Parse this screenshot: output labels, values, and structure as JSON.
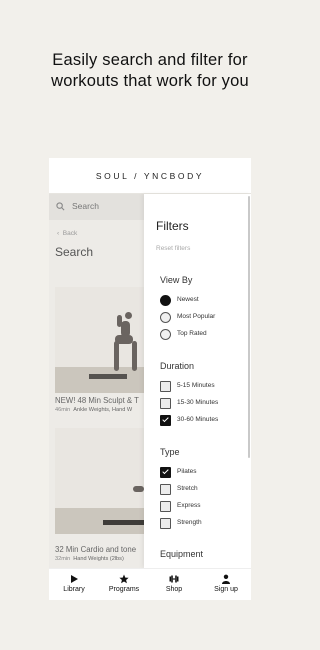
{
  "headline": {
    "line1": "Easily search and filter for",
    "line2": "workouts that work for you"
  },
  "brand": "SOUL / YNCBODY",
  "background_list": {
    "search_placeholder": "Search",
    "back_label": "Back",
    "title": "Search",
    "cards": [
      {
        "title": "NEW! 48 Min Sculpt & T",
        "duration": "46min",
        "equipment": "Ankle Weights, Hand W"
      },
      {
        "title": "32 Min Cardio and tone",
        "duration": "32min",
        "equipment": "Hand Weights (2lbs)"
      }
    ]
  },
  "filters": {
    "title": "Filters",
    "reset_label": "Reset filters",
    "view_by": {
      "heading": "View By",
      "options": [
        {
          "label": "Newest",
          "selected": true
        },
        {
          "label": "Most Popular",
          "selected": false
        },
        {
          "label": "Top Rated",
          "selected": false
        }
      ]
    },
    "duration": {
      "heading": "Duration",
      "options": [
        {
          "label": "5-15 Minutes",
          "checked": false
        },
        {
          "label": "15-30 Minutes",
          "checked": false
        },
        {
          "label": "30-60 Minutes",
          "checked": true
        }
      ]
    },
    "type": {
      "heading": "Type",
      "options": [
        {
          "label": "Pilates",
          "checked": true
        },
        {
          "label": "Stretch",
          "checked": false
        },
        {
          "label": "Express",
          "checked": false
        },
        {
          "label": "Strength",
          "checked": false
        }
      ]
    },
    "equipment": {
      "heading": "Equipment"
    }
  },
  "tabbar": {
    "items": [
      {
        "label": "Library",
        "icon": "play-icon"
      },
      {
        "label": "Programs",
        "icon": "star-icon"
      },
      {
        "label": "Shop",
        "icon": "dumbbell-icon"
      },
      {
        "label": "Sign up",
        "icon": "person-icon"
      }
    ]
  },
  "colors": {
    "page_bg": "#f2f0eb",
    "selected": "#111111"
  }
}
